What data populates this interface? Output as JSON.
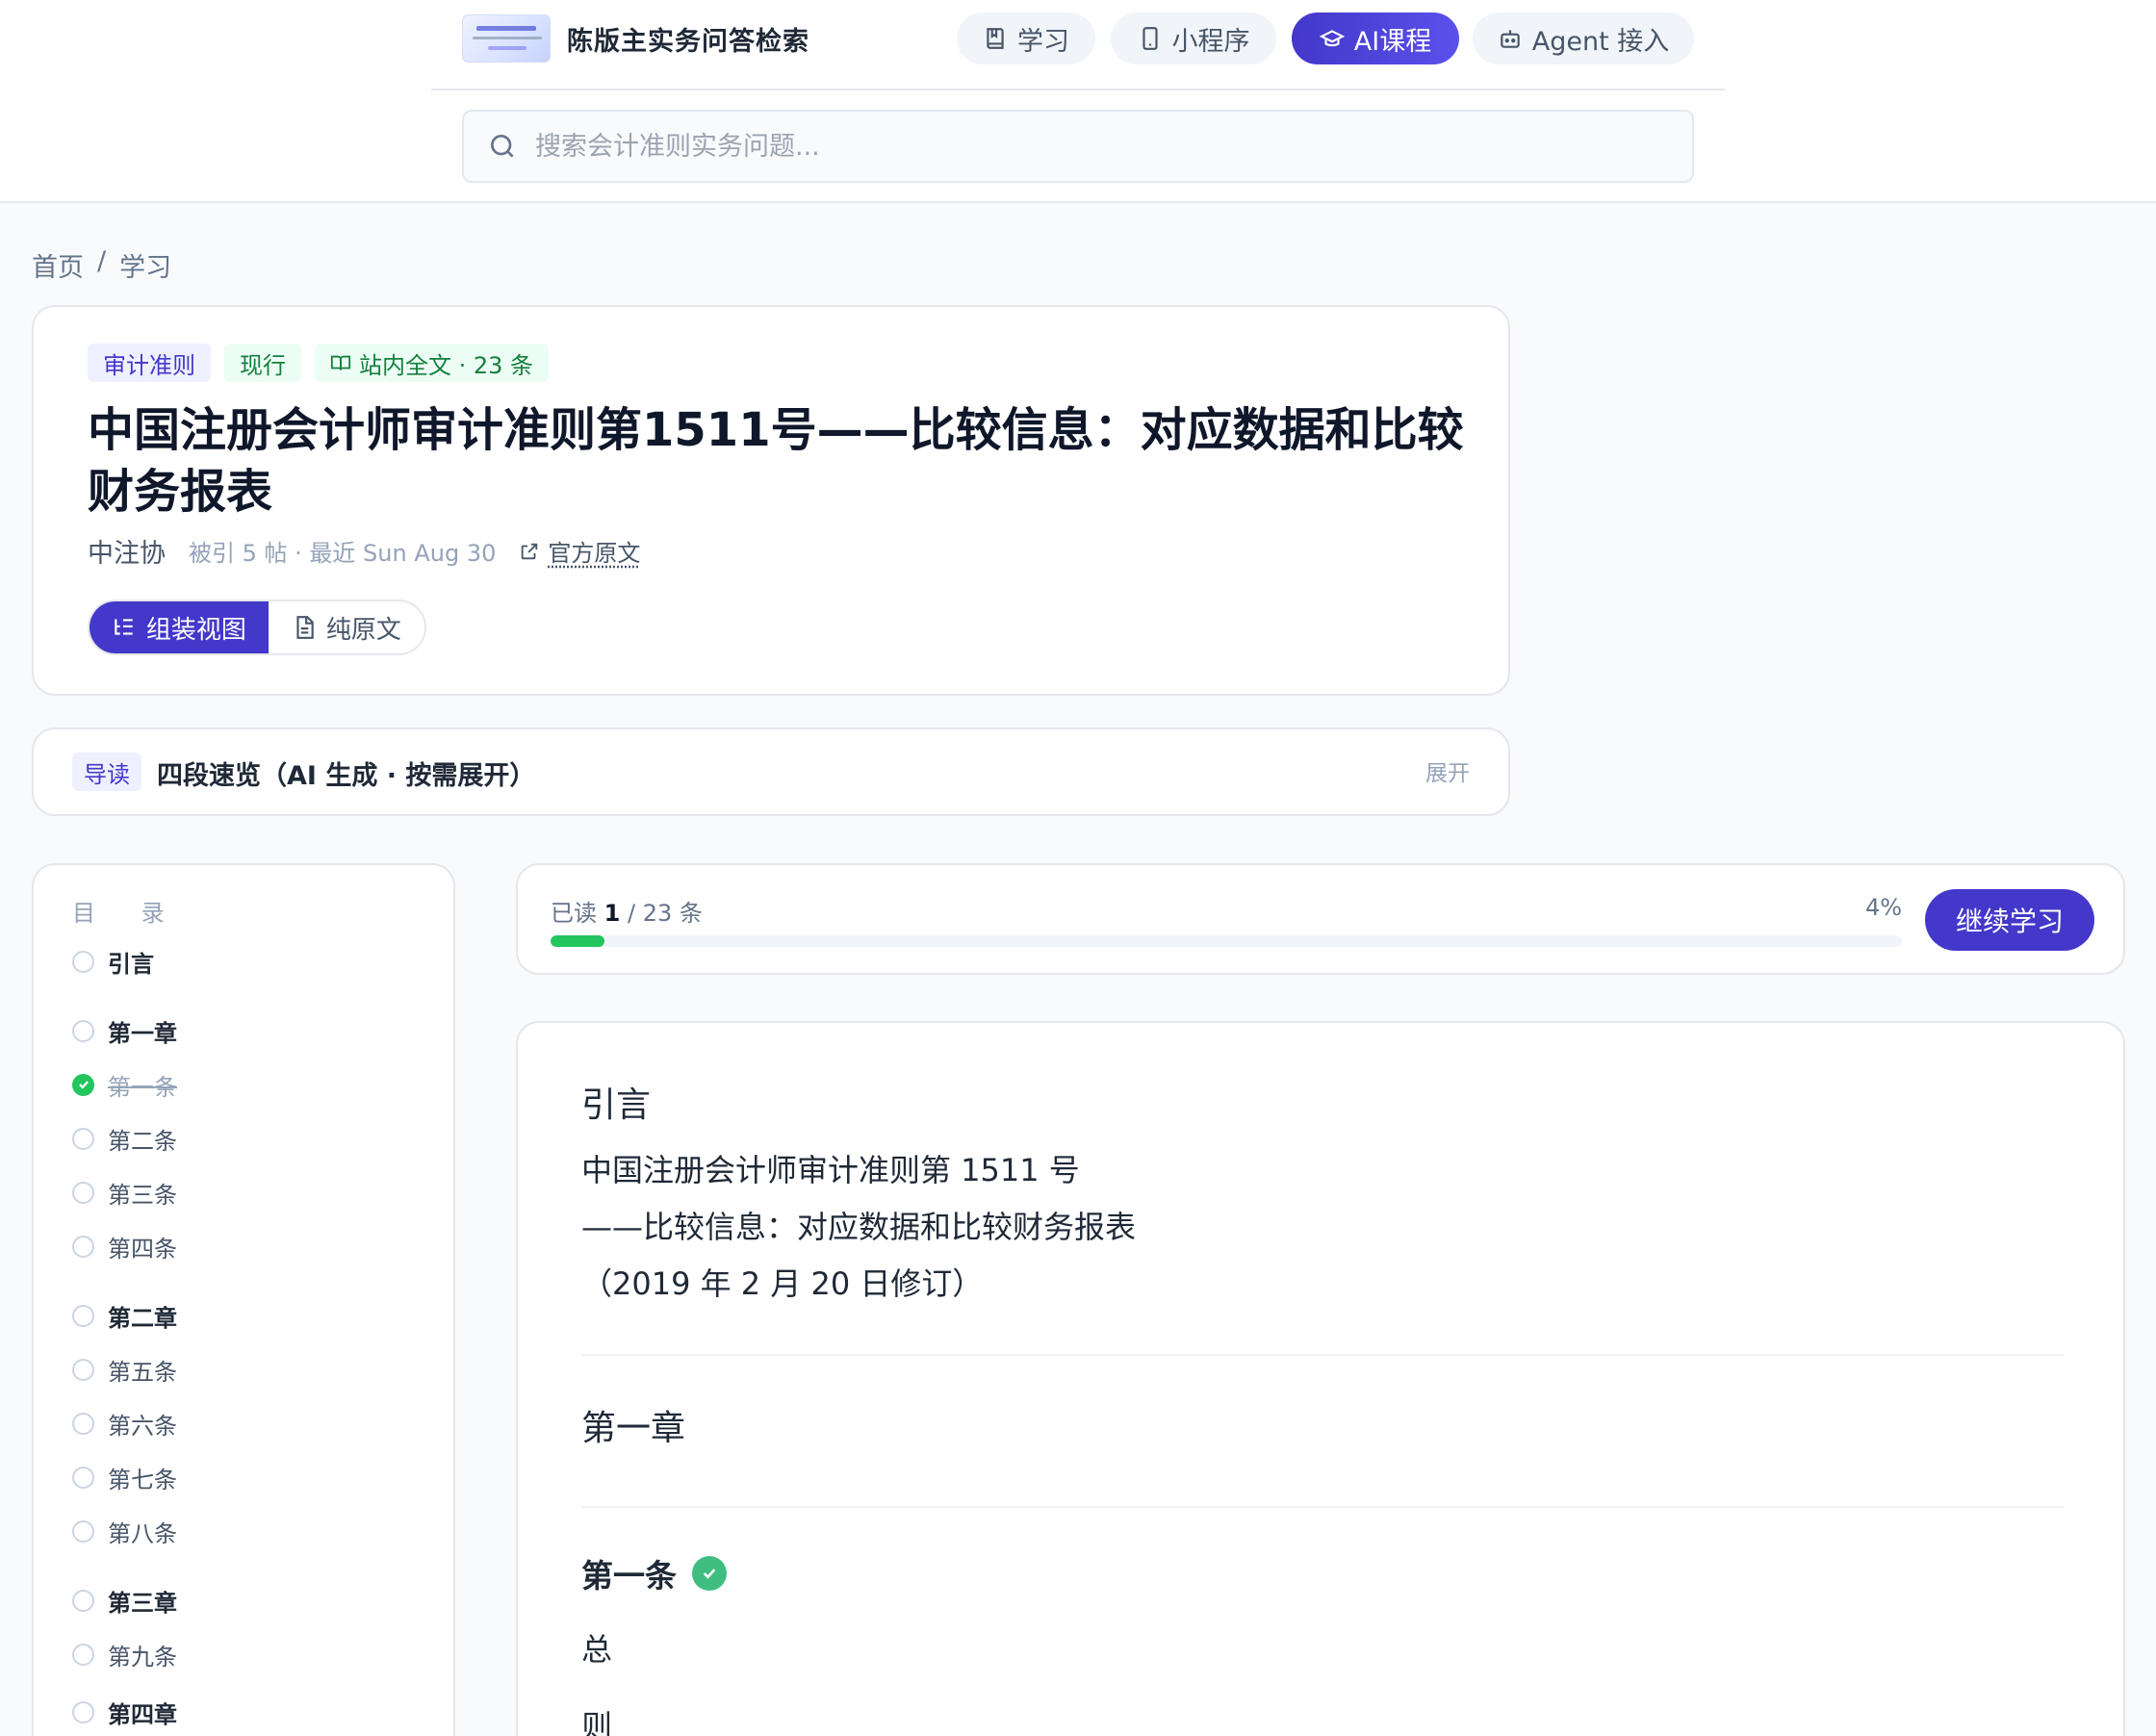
{
  "header": {
    "site_title": "陈版主实务问答检索",
    "nav": [
      {
        "label": "学习",
        "icon": "book-icon",
        "active": false
      },
      {
        "label": "小程序",
        "icon": "phone-icon",
        "active": false
      },
      {
        "label": "AI课程",
        "icon": "graduation-cap-icon",
        "active": true
      },
      {
        "label": "Agent 接入",
        "icon": "robot-icon",
        "active": false
      }
    ],
    "search_placeholder": "搜索会计准则实务问题..."
  },
  "breadcrumb": {
    "home": "首页",
    "sep": "/",
    "current": "学习"
  },
  "standard": {
    "tags": [
      "审计准则",
      "现行",
      "站内全文 · 23 条"
    ],
    "title": "中国注册会计师审计准则第1511号——比较信息：对应数据和比较财务报表",
    "org": "中注协",
    "cite": "被引 5 帖 · 最近 Sun Aug 30",
    "official_link": "官方原文",
    "view_assembled": "组装视图",
    "view_plain": "纯原文"
  },
  "guide": {
    "badge": "导读",
    "text": "四段速览（AI 生成 · 按需展开）",
    "expand": "展开"
  },
  "toc": {
    "title": "目 录",
    "items": [
      {
        "label": "引言",
        "type": "chapter",
        "status": "unread"
      },
      {
        "label": "第一章",
        "type": "chapter",
        "status": "unread"
      },
      {
        "label": "第一条",
        "type": "article",
        "status": "read"
      },
      {
        "label": "第二条",
        "type": "article",
        "status": "unread"
      },
      {
        "label": "第三条",
        "type": "article",
        "status": "unread"
      },
      {
        "label": "第四条",
        "type": "article",
        "status": "unread"
      },
      {
        "label": "第二章",
        "type": "chapter",
        "status": "unread"
      },
      {
        "label": "第五条",
        "type": "article",
        "status": "unread"
      },
      {
        "label": "第六条",
        "type": "article",
        "status": "unread"
      },
      {
        "label": "第七条",
        "type": "article",
        "status": "unread"
      },
      {
        "label": "第八条",
        "type": "article",
        "status": "unread"
      },
      {
        "label": "第三章",
        "type": "chapter",
        "status": "unread"
      },
      {
        "label": "第九条",
        "type": "article",
        "status": "unread"
      },
      {
        "label": "第四章",
        "type": "chapter",
        "status": "unread"
      }
    ]
  },
  "progress": {
    "prefix": "已读",
    "read": "1",
    "total_text": "/ 23 条",
    "percent_text": "4%",
    "fraction": 0.04,
    "continue_label": "继续学习"
  },
  "content": {
    "intro_heading": "引言",
    "intro_lines": [
      "中国注册会计师审计准则第 1511 号",
      "——比较信息：对应数据和比较财务报表",
      "（2019 年 2 月 20 日修订）"
    ],
    "chapter_heading": "第一章",
    "article_heading": "第一条",
    "article_chars": [
      "总",
      "则"
    ]
  },
  "colors": {
    "accent": "#4338ca",
    "success": "#22c55e"
  }
}
